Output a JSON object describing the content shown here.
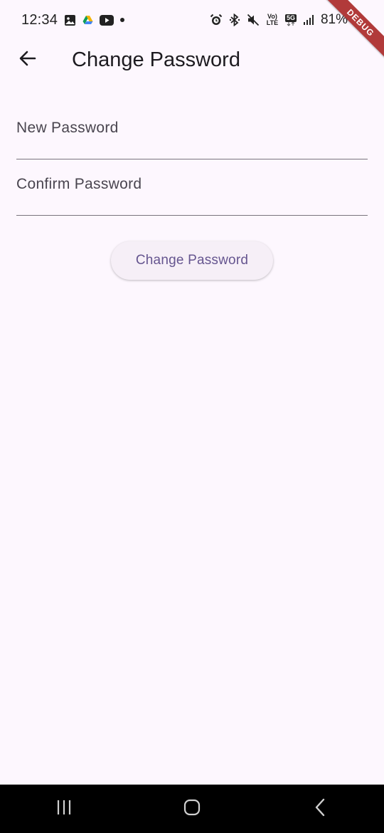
{
  "status_bar": {
    "time": "12:34",
    "battery_percent": "81%",
    "network": "5G",
    "volte_label": "Vo) LTE",
    "icons": [
      "gallery-icon",
      "drive-icon",
      "youtube-icon",
      "notification-dot",
      "alarm-icon",
      "bluetooth-icon",
      "mute-icon",
      "volte-icon",
      "5g-icon",
      "signal-icon",
      "battery-icon"
    ]
  },
  "debug_banner": "DEBUG",
  "app_bar": {
    "back_icon": "arrow-back-icon",
    "title": "Change Password"
  },
  "form": {
    "new_password_label": "New Password",
    "confirm_password_label": "Confirm Password",
    "submit_label": "Change Password"
  },
  "nav_bar": {
    "icons": [
      "recent-apps-icon",
      "home-icon",
      "back-icon"
    ]
  },
  "colors": {
    "background": "#fdf7fe",
    "button_text": "#65558f",
    "button_bg": "#f6eff7",
    "field_underline": "#79747e",
    "nav_bar": "#000000",
    "debug_banner": "#b13a3a"
  }
}
